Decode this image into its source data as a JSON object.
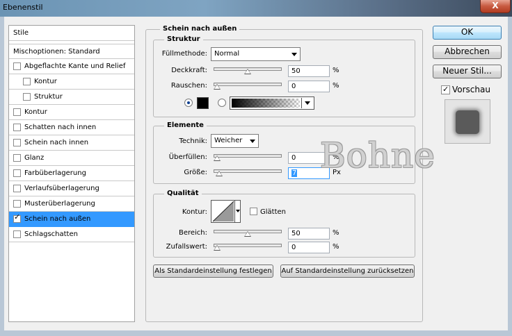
{
  "window": {
    "title": "Ebenenstil",
    "close_glyph": "X"
  },
  "styles_list": {
    "header": "Stile",
    "blend_options": "Mischoptionen: Standard",
    "items": [
      {
        "label": "Abgeflachte Kante und Relief",
        "checked": false,
        "indent": false
      },
      {
        "label": "Kontur",
        "checked": false,
        "indent": true
      },
      {
        "label": "Struktur",
        "checked": false,
        "indent": true
      },
      {
        "label": "Kontur",
        "checked": false,
        "indent": false
      },
      {
        "label": "Schatten nach innen",
        "checked": false,
        "indent": false
      },
      {
        "label": "Schein nach innen",
        "checked": false,
        "indent": false
      },
      {
        "label": "Glanz",
        "checked": false,
        "indent": false
      },
      {
        "label": "Farbüberlagerung",
        "checked": false,
        "indent": false
      },
      {
        "label": "Verlaufsüberlagerung",
        "checked": false,
        "indent": false
      },
      {
        "label": "Musterüberlagerung",
        "checked": false,
        "indent": false
      },
      {
        "label": "Schein nach außen",
        "checked": true,
        "indent": false,
        "selected": true
      },
      {
        "label": "Schlagschatten",
        "checked": false,
        "indent": false
      }
    ]
  },
  "outer_glow": {
    "title": "Schein nach außen",
    "structure": {
      "title": "Struktur",
      "blend_mode_label": "Füllmethode:",
      "blend_mode_value": "Normal",
      "opacity_label": "Deckkraft:",
      "opacity_value": "50",
      "opacity_level": 50,
      "noise_label": "Rauschen:",
      "noise_value": "0",
      "noise_level": 0,
      "unit": "%",
      "color_mode": "solid",
      "color": "#000000"
    },
    "elements": {
      "title": "Elemente",
      "technique_label": "Technik:",
      "technique_value": "Weicher",
      "spread_label": "Überfüllen:",
      "spread_value": "0",
      "spread_level": 0,
      "size_label": "Größe:",
      "size_value": "7",
      "size_level": 3,
      "size_unit": "Px",
      "spread_unit": "%"
    },
    "quality": {
      "title": "Qualität",
      "contour_label": "Kontur:",
      "antialias_label": "Glätten",
      "antialias_checked": false,
      "range_label": "Bereich:",
      "range_value": "50",
      "range_level": 50,
      "jitter_label": "Zufallswert:",
      "jitter_value": "0",
      "jitter_level": 0,
      "unit": "%"
    },
    "make_default": "Als Standardeinstellung festlegen",
    "reset_default": "Auf Standardeinstellung zurücksetzen"
  },
  "buttons": {
    "ok": "OK",
    "cancel": "Abbrechen",
    "new_style": "Neuer Stil...",
    "preview_label": "Vorschau",
    "preview_checked": true
  },
  "watermark": "Bohne",
  "colors": {
    "selection": "#3399ff",
    "preview_swatch": "#5a5a5a"
  }
}
